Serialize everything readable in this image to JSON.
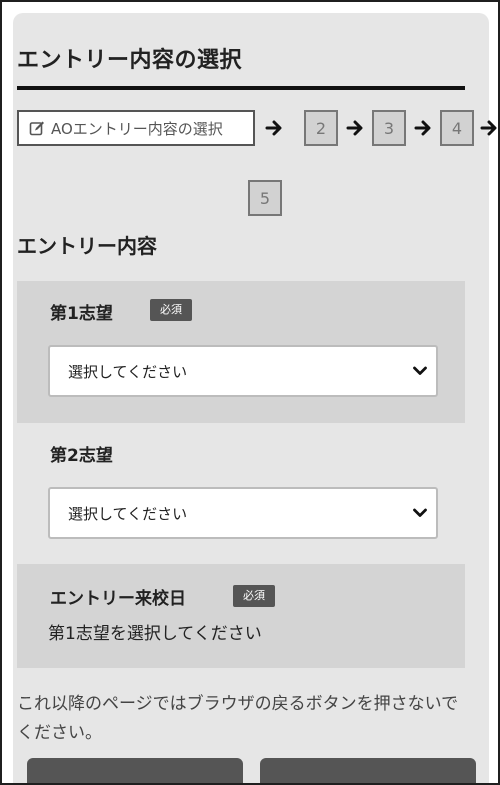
{
  "page": {
    "title": "エントリー内容の選択"
  },
  "steps": {
    "current_label": "AOエントリー内容の選択",
    "items": [
      "2",
      "3",
      "4",
      "5"
    ]
  },
  "section": {
    "heading": "エントリー内容"
  },
  "first_choice": {
    "label": "第1志望",
    "badge": "必須",
    "select_value": "選択してください"
  },
  "second_choice": {
    "label": "第2志望",
    "select_value": "選択してください"
  },
  "visit_date": {
    "label": "エントリー来校日",
    "badge": "必須",
    "message": "第1志望を選択してください"
  },
  "notice": {
    "text": "これ以降のページではブラウザの戻るボタンを押さないでください。"
  },
  "colors": {
    "panel_bg": "#e6e6e6",
    "shaded_block": "#d4d4d4",
    "badge_bg": "#555555",
    "button_bg": "#555555"
  }
}
